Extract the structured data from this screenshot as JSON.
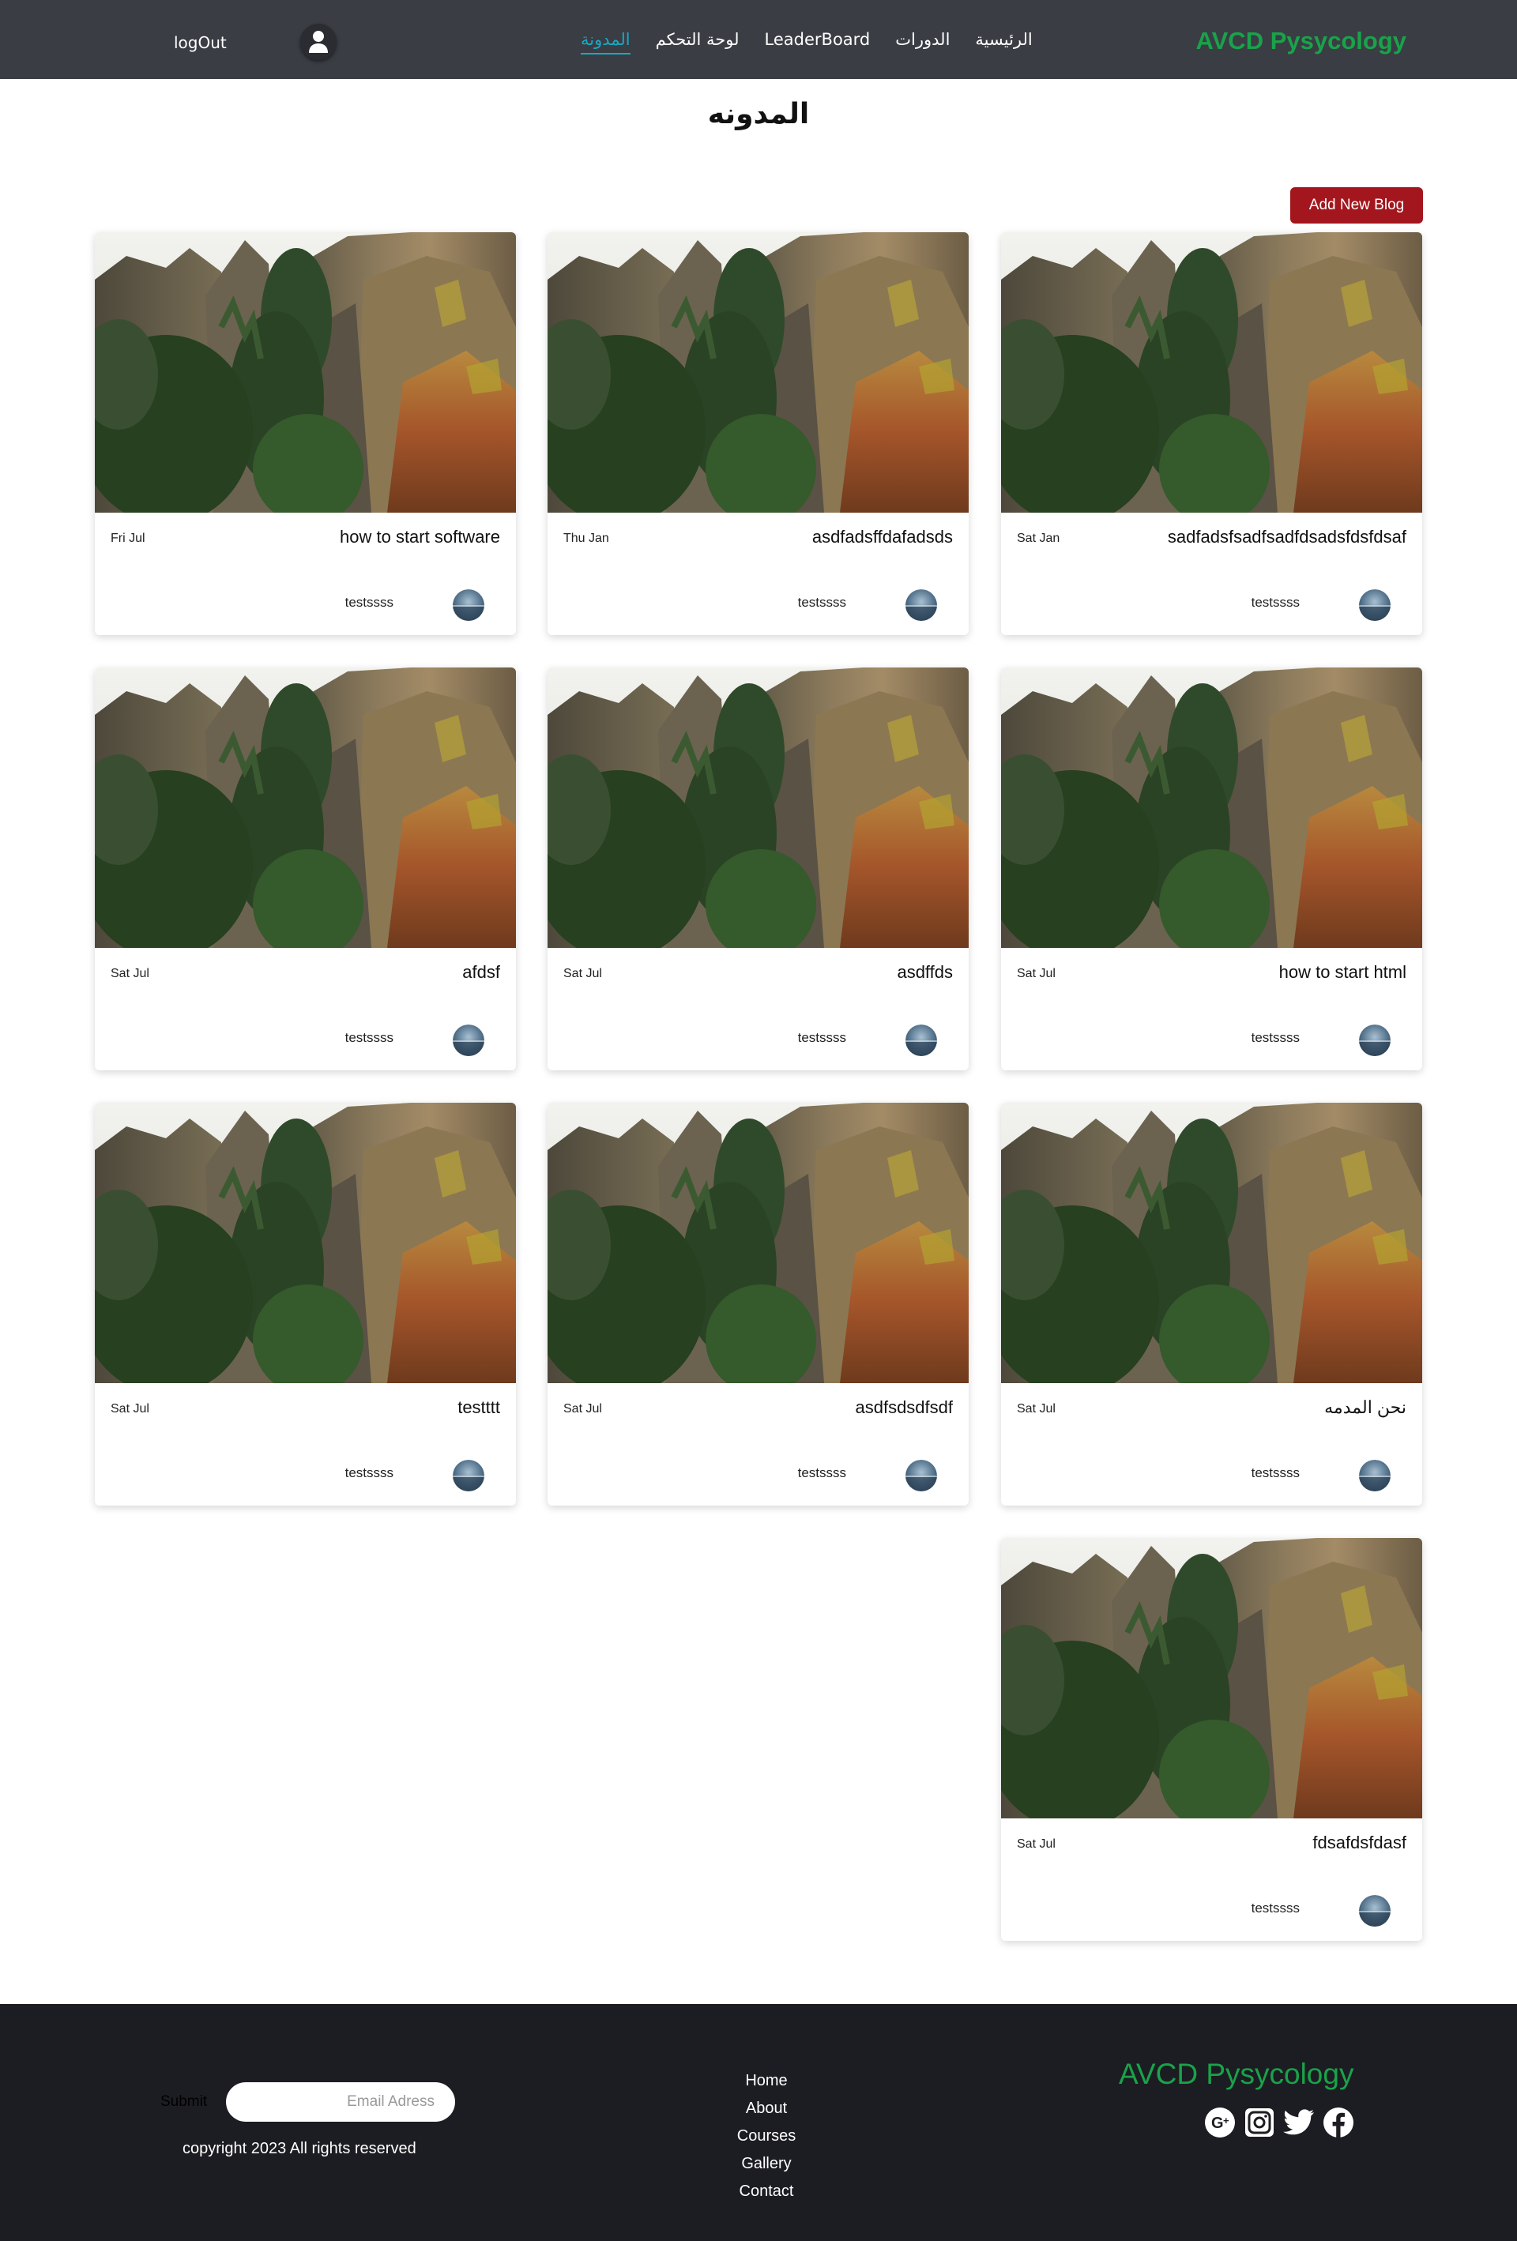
{
  "nav": {
    "brand": "AVCD Pysycology",
    "links": [
      {
        "label": "الرئيسية"
      },
      {
        "label": "الدورات"
      },
      {
        "label": "LeaderBoard"
      },
      {
        "label": "لوحة التحكم"
      },
      {
        "label": "المدونة"
      }
    ],
    "active_link": "المدونة",
    "user_icon": "user-icon",
    "logout_label": "logOut"
  },
  "page": {
    "title": "المدونه",
    "add_button_label": "Add New Blog"
  },
  "blogs": [
    {
      "title": "sadfadsfsadfsadfdsadsfdsfdsaf",
      "date": "Sat Jan",
      "author": "testssss"
    },
    {
      "title": "asdfadsffdafadsds",
      "date": "Thu Jan",
      "author": "testssss"
    },
    {
      "title": "how to start software",
      "date": "Fri Jul",
      "author": "testssss"
    },
    {
      "title": "how to start html",
      "date": "Sat Jul",
      "author": "testssss"
    },
    {
      "title": "asdffds",
      "date": "Sat Jul",
      "author": "testssss"
    },
    {
      "title": "afdsf",
      "date": "Sat Jul",
      "author": "testssss"
    },
    {
      "title": "نحن المدمه",
      "date": "Sat Jul",
      "author": "testssss"
    },
    {
      "title": "asdfsdsdfsdf",
      "date": "Sat Jul",
      "author": "testssss"
    },
    {
      "title": "testttt",
      "date": "Sat Jul",
      "author": "testssss"
    },
    {
      "title": "fdsafdsfdasf",
      "date": "Sat Jul",
      "author": "testssss"
    }
  ],
  "footer": {
    "brand": "AVCD Pysycology",
    "social_icons": [
      "google-plus-icon",
      "instagram-icon",
      "twitter-icon",
      "facebook-icon"
    ],
    "links": [
      {
        "label": "Home"
      },
      {
        "label": "About"
      },
      {
        "label": "Courses"
      },
      {
        "label": "Gallery"
      },
      {
        "label": "Contact"
      }
    ],
    "submit_label": "Submit",
    "email_placeholder": "Email Adress",
    "copyright": "copyright 2023 All rights reserved"
  },
  "colors": {
    "navbar_bg": "#3a3d44",
    "brand_green": "#1aa24a",
    "active_link": "#18a9c3",
    "button_red": "#a3161d",
    "footer_bg": "#1c1d22"
  }
}
